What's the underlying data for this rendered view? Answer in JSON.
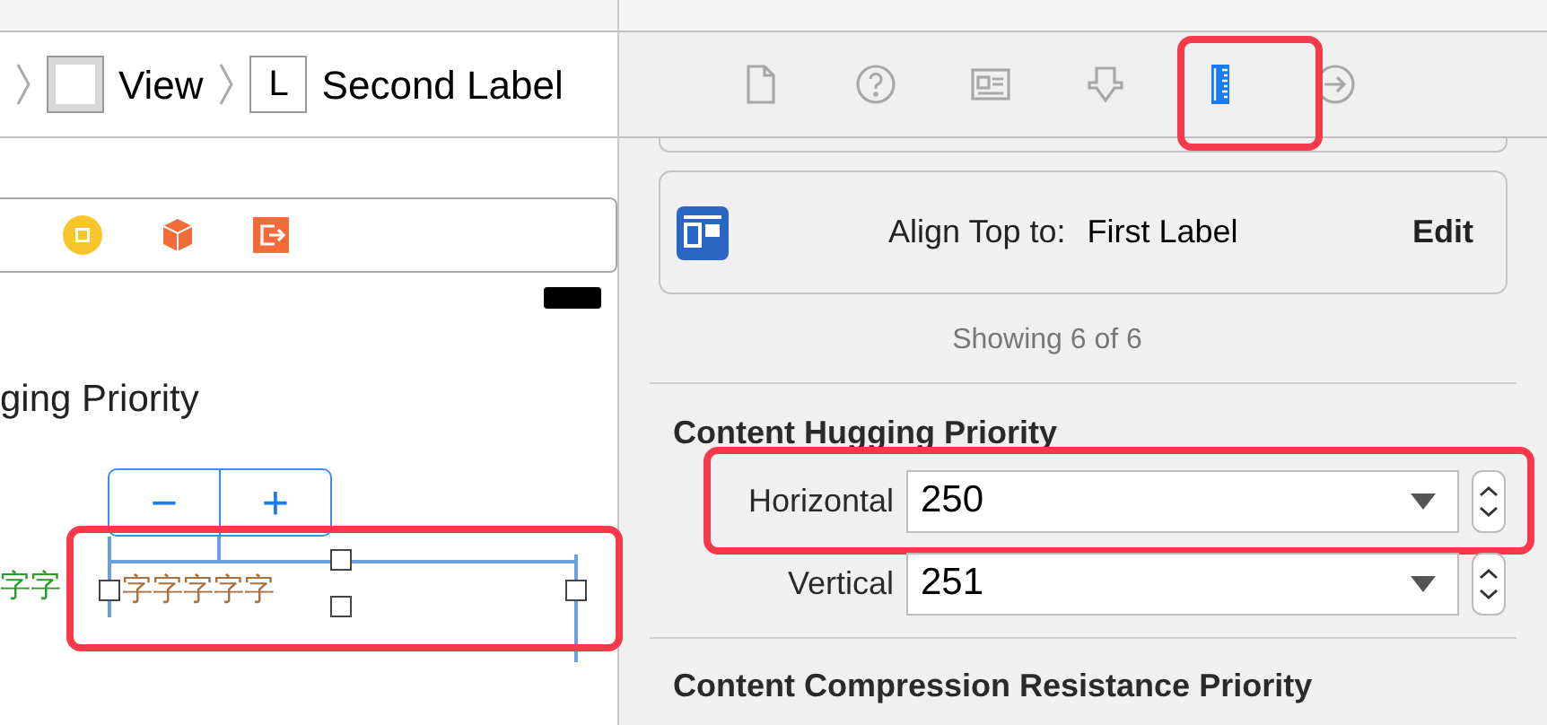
{
  "breadcrumb": [
    {
      "kind": "view",
      "label": "View"
    },
    {
      "kind": "label",
      "glyph": "L",
      "label": "Second Label"
    }
  ],
  "canvas": {
    "heading": "ging Priority",
    "stepper": {
      "minus": "−",
      "plus": "+"
    },
    "label_first": "字字",
    "label_second": "字字字字字"
  },
  "inspector": {
    "tabs": [
      {
        "kind": "file",
        "selected": false
      },
      {
        "kind": "help",
        "selected": false
      },
      {
        "kind": "identity",
        "selected": false
      },
      {
        "kind": "attributes",
        "selected": false
      },
      {
        "kind": "size",
        "selected": true
      },
      {
        "kind": "connections",
        "selected": false
      }
    ],
    "constraint": {
      "label": "Align Top to:",
      "target": "First Label",
      "action": "Edit"
    },
    "showing": "Showing 6 of 6",
    "hugging": {
      "title": "Content Hugging Priority",
      "rows": [
        {
          "label": "Horizontal",
          "value": "250",
          "highlighted": true
        },
        {
          "label": "Vertical",
          "value": "251",
          "highlighted": false
        }
      ]
    },
    "compression": {
      "title": "Content Compression Resistance Priority"
    }
  }
}
